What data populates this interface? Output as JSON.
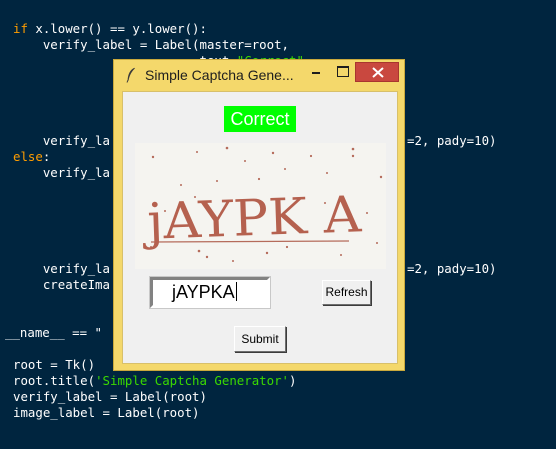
{
  "editor": {
    "lines": [
      {
        "segments": [
          {
            "text": "if",
            "class": "kw"
          },
          {
            "text": " x.lower() == y.lower():"
          }
        ]
      },
      {
        "segments": [
          {
            "text": "    verify_label = Label(master=root,"
          }
        ]
      },
      {
        "segments": [
          {
            "text": "                         text="
          },
          {
            "text": "\"Correct\"",
            "class": "str"
          }
        ]
      },
      {
        "segments": [
          {
            "text": "    verify_la"
          }
        ]
      },
      {
        "segments": [
          {
            "text": "else",
            "class": "kw"
          },
          {
            "text": ":"
          }
        ]
      },
      {
        "segments": [
          {
            "text": "    verify_la"
          }
        ]
      },
      {
        "segments": [
          {
            "text": "    verify_la"
          }
        ]
      },
      {
        "segments": [
          {
            "text": "    createIma"
          }
        ]
      },
      {
        "segments": [
          {
            "text": "__name__ == \""
          }
        ]
      },
      {
        "segments": [
          {
            "text": "root = Tk()"
          }
        ]
      },
      {
        "segments": [
          {
            "text": "root.title("
          },
          {
            "text": "'Simple Captcha Generator'",
            "class": "str"
          },
          {
            "text": ")"
          }
        ]
      },
      {
        "segments": [
          {
            "text": "verify_label = Label(root)"
          }
        ]
      },
      {
        "segments": [
          {
            "text": "image_label = Label(root)"
          }
        ]
      },
      {
        "segments": [
          {
            "text": "=2, pady=10)"
          }
        ]
      },
      {
        "segments": [
          {
            "text": "=2, pady=10)"
          }
        ]
      }
    ]
  },
  "window": {
    "title": "Simple Captcha Gene...",
    "status_text": "Correct",
    "status_color": "#00ff00",
    "captcha_text": "jAYPK A",
    "input_value": "jAYPKA",
    "refresh_label": "Refresh",
    "submit_label": "Submit"
  },
  "colors": {
    "editor_bg": "#00253f",
    "keyword": "#ff9d00",
    "string": "#3ad900",
    "window_frame": "#f4d86b",
    "close_button": "#c9483f",
    "captcha_ink": "#b5614f"
  },
  "icons": [
    "feather-icon",
    "minimize-icon",
    "maximize-icon",
    "close-icon"
  ]
}
